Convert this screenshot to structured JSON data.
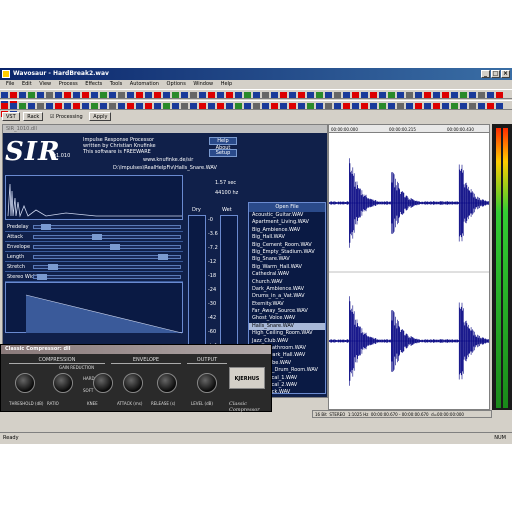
{
  "window": {
    "title": "Wavosaur - HardBreak2.wav"
  },
  "menu": [
    "File",
    "Edit",
    "View",
    "Process",
    "Effects",
    "Tools",
    "Automation",
    "Options",
    "Window",
    "Help"
  ],
  "vst_bar": {
    "vst": "VST",
    "rack": "Rack",
    "processing": "Processing",
    "apply": "Apply"
  },
  "sir": {
    "window_title": "SIR_1010.dll",
    "logo": "SIR",
    "version": "v1.010",
    "desc1": "Impulse Response Processor",
    "desc2": "written by Christian Knufinke",
    "desc3": "This software is FREEWARE",
    "url": "www.knufinke.de/sir",
    "filepath": "D:\\Impulses\\RealHelpFiv\\Halls_Snare.WAV",
    "about_btn": "Help About",
    "setup_btn": "Setup",
    "length_value": "1.57 sec",
    "rate_value": "44100 hz",
    "open_file": "Open File",
    "dry_label": "Dry",
    "wet_label": "Wet",
    "params": [
      {
        "label": "Predelay",
        "value": 0.05
      },
      {
        "label": "Attack",
        "value": 0.42
      },
      {
        "label": "Envelope",
        "value": 0.55
      },
      {
        "label": "Length",
        "value": 0.9
      },
      {
        "label": "Stretch",
        "value": 0.1
      },
      {
        "label": "Stereo Width",
        "value": 0.02
      }
    ],
    "meter_scale": [
      "-0",
      "-3.6",
      "-7.2",
      "-12",
      "-18",
      "-24",
      "-30",
      "-42",
      "-60",
      "-inf"
    ],
    "files": [
      "Acoustic_Guitar.WAV",
      "Apartment_Living.WAV",
      "Big_Ambience.WAV",
      "Big_Hall.WAV",
      "Big_Cement_Room.WAV",
      "Big_Empty_Stadium.WAV",
      "Big_Snare.WAV",
      "Big_Warm_Hall.WAV",
      "Cathedral.WAV",
      "Church.WAV",
      "Dark_Ambience.WAV",
      "Drums_in_a_Vat.WAV",
      "Eternity.WAV",
      "Far_Away_Source.WAV",
      "Ghost_Voice.WAV",
      "Halls_Snare.WAV",
      "High_Ceiling_Room.WAV",
      "Jazz_Club.WAV",
      "Large_Bathroom.WAV",
      "Large_Dark_Hall.WAV",
      "Long_Tube.WAV",
      "Medium_Drum_Room.WAV",
      "Nice_Vocal_1.WAV",
      "Nice_Vocal_2.WAV",
      "Slap_Back.WAV"
    ],
    "selected_file_index": 15
  },
  "wave": {
    "ruler": [
      "00:00:00.000",
      "00:00:00.215",
      "00:00:00.430"
    ],
    "status": [
      "16 Bit",
      "STEREO",
      "1:1025 Hz",
      "00:00:00.670 - 00:00:00.670",
      "d=00:00:00:000"
    ]
  },
  "compressor": {
    "title": "Classic Compressor: dll",
    "brand": "Classic Compressor",
    "sections": {
      "compression": "COMPRESSION",
      "envelope": "ENVELOPE",
      "output": "OUTPUT",
      "gain_reduction": "GAIN REDUCTION",
      "hard": "HARD",
      "soft": "SOFT"
    },
    "knobs": [
      {
        "label": "THRESHOLD (dB)"
      },
      {
        "label": "RATIO"
      },
      {
        "label": "KNEE"
      },
      {
        "label": "ATTACK (ms)"
      },
      {
        "label": "RELEASE (s)"
      },
      {
        "label": "LEVEL (dB)"
      }
    ],
    "logo_text": "KJERHUS"
  },
  "statusbar": {
    "left": "Ready",
    "right": "NUM"
  },
  "colors": {
    "title_bg": "#0a246a",
    "sir_bg": "#10204a",
    "wave": "#000080",
    "comp_bg": "#2a2a2a"
  }
}
